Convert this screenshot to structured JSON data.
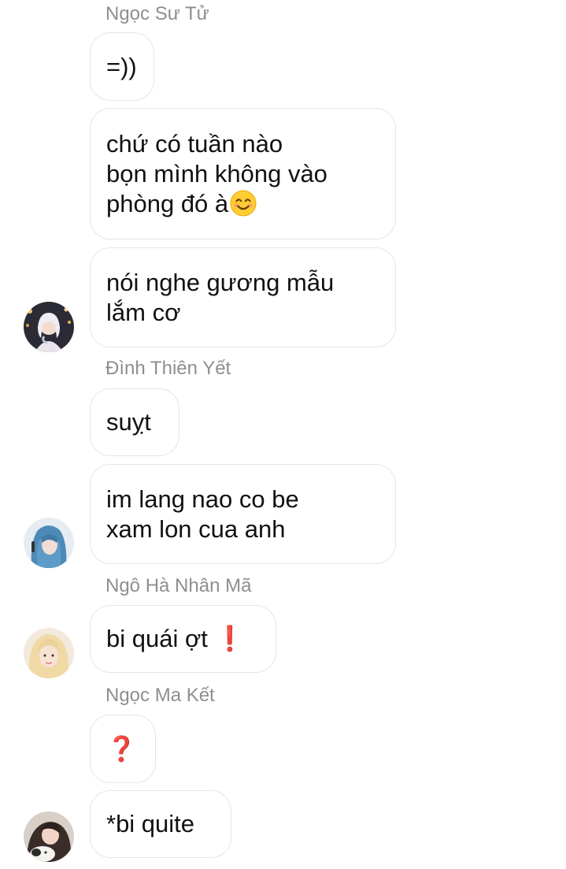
{
  "chat": {
    "messages": [
      {
        "sender": "Ngọc Sư Tử",
        "lines": [
          "=))"
        ]
      },
      {
        "lines": [
          "chứ có tuần nào",
          "bọn mình không vào",
          "phòng đó à"
        ],
        "trailing_icon": "smiling-face-emoji"
      },
      {
        "lines": [
          "nói nghe gương mẫu",
          "lắm cơ"
        ],
        "avatar": "avatar-1"
      },
      {
        "sender": "Đình Thiên Yết",
        "lines": [
          "suỵt"
        ]
      },
      {
        "lines": [
          "im lang nao co be",
          "xam lon cua anh"
        ],
        "avatar": "avatar-2"
      },
      {
        "sender": "Ngô Hà Nhân Mã",
        "lines": [
          "bi quái ợt"
        ],
        "trailing_icon": "red-exclamation-emoji",
        "avatar": "avatar-3"
      },
      {
        "sender": "Ngọc Ma Kết",
        "lines": [
          "❓"
        ]
      },
      {
        "lines": [
          "*bi quite"
        ],
        "avatar": "avatar-4"
      }
    ],
    "emoji": {
      "exclamation": "❗",
      "question": "❓"
    }
  },
  "colors": {
    "bubble_border": "#e6e6e6",
    "sender_name": "#8e8e8e",
    "message_text": "#111111",
    "emoji_red": "#e0222b"
  }
}
